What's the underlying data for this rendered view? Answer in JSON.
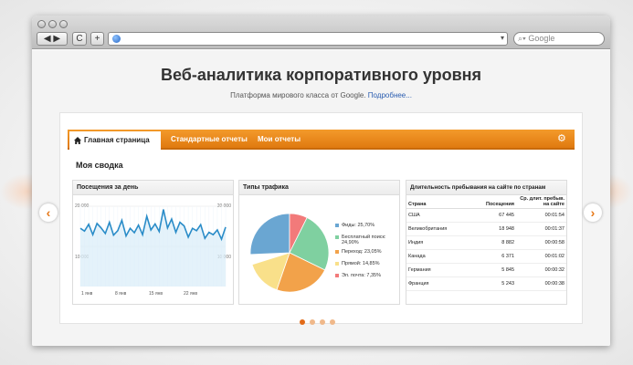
{
  "browser": {
    "back_label": "◀ ▶",
    "reload_label": "C",
    "add_label": "+",
    "search_placeholder": "Google"
  },
  "page": {
    "title": "Веб-аналитика корпоративного уровня",
    "subtitle": "Платформа мирового класса от Google.",
    "subtitle_link": "Подробнее..."
  },
  "tabs": {
    "home": "Главная страница",
    "standard": "Стандартные отчеты",
    "mine": "Мои отчеты"
  },
  "summary": "Моя сводка",
  "visits_panel": {
    "title": "Посещения за день",
    "ytick_top_left": "20 000",
    "ytick_mid_left": "10 000",
    "ytick_top_right": "20 000",
    "ytick_mid_right": "10 000",
    "dates": [
      "1 янв",
      "8 янв",
      "15 янв",
      "22 янв"
    ]
  },
  "chart_data": {
    "type": "line",
    "ylim": [
      0,
      20000
    ],
    "values": [
      14500,
      13800,
      15500,
      12900,
      15700,
      14600,
      13200,
      16000,
      12800,
      13900,
      16500,
      12600,
      14500,
      13400,
      15300,
      12900,
      17500,
      14100,
      15600,
      13700,
      19200,
      14600,
      16800,
      13500,
      16000,
      15100,
      12300,
      14500,
      13900,
      15400,
      12000,
      13500,
      12900,
      14100,
      11800,
      14800
    ],
    "pie": {
      "type": "pie",
      "title": "Типы трафика",
      "slices": [
        {
          "label": "Фиды: 25,70%",
          "value": 25.7,
          "color": "#7fd0a0"
        },
        {
          "label": "Бесплатный поиск: 24,90%",
          "value": 24.9,
          "color": "#f2a24a"
        },
        {
          "label": "Переход: 23,05%",
          "value": 23.05,
          "color": "#f9e08a"
        },
        {
          "label": "Прямой: 14,85%",
          "value": 14.85,
          "color": "#6aa6d2"
        },
        {
          "label": "Эл. почта: 7,35%",
          "value": 7.35,
          "color": "#f27a7a"
        }
      ]
    }
  },
  "table_panel": {
    "title": "Длительность пребывания на сайте по странам",
    "headers": [
      "Страна",
      "Посещения",
      "Ср. длит. пребыв. на сайте"
    ],
    "rows": [
      [
        "США",
        "67 445",
        "00:01:54"
      ],
      [
        "Великобритания",
        "18 948",
        "00:01:37"
      ],
      [
        "Индия",
        "8 882",
        "00:00:58"
      ],
      [
        "Канада",
        "6 371",
        "00:01:02"
      ],
      [
        "Германия",
        "5 845",
        "00:00:32"
      ],
      [
        "Франция",
        "5 243",
        "00:00:38"
      ]
    ]
  },
  "colors": {
    "accent": "#e8841d",
    "line": "#2a8cc8",
    "area": "#d9ecf8"
  },
  "slider": {
    "active_index": 0,
    "count": 4
  }
}
